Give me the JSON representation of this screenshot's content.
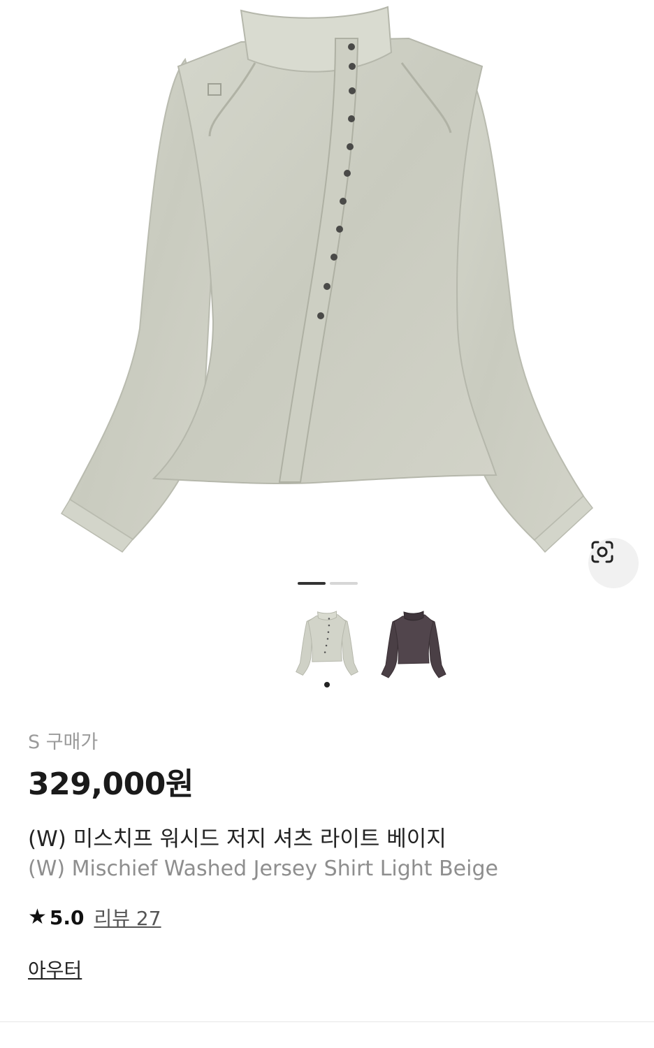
{
  "product": {
    "size_label": "S 구매가",
    "price": "329,000원",
    "name_ko": "(W) 미스치프 워시드 저지 셔츠 라이트 베이지",
    "name_en": "(W) Mischief Washed Jersey Shirt Light Beige",
    "rating": "5.0",
    "reviews_label": "리뷰 27",
    "category": "아우터"
  },
  "gallery": {
    "current_slide": 1,
    "total_slides": 2,
    "colors": {
      "indicator_active": "#333333",
      "indicator_inactive": "#d6d6d6",
      "shirt_main": "#cfd1c6",
      "shirt_alt": "#4a3f45"
    },
    "thumbnails": [
      {
        "name": "light-beige-variant",
        "selected": true
      },
      {
        "name": "dark-variant",
        "selected": false
      }
    ],
    "lens_icon": "camera-lens-search-icon"
  },
  "icons": {
    "star": "★"
  }
}
